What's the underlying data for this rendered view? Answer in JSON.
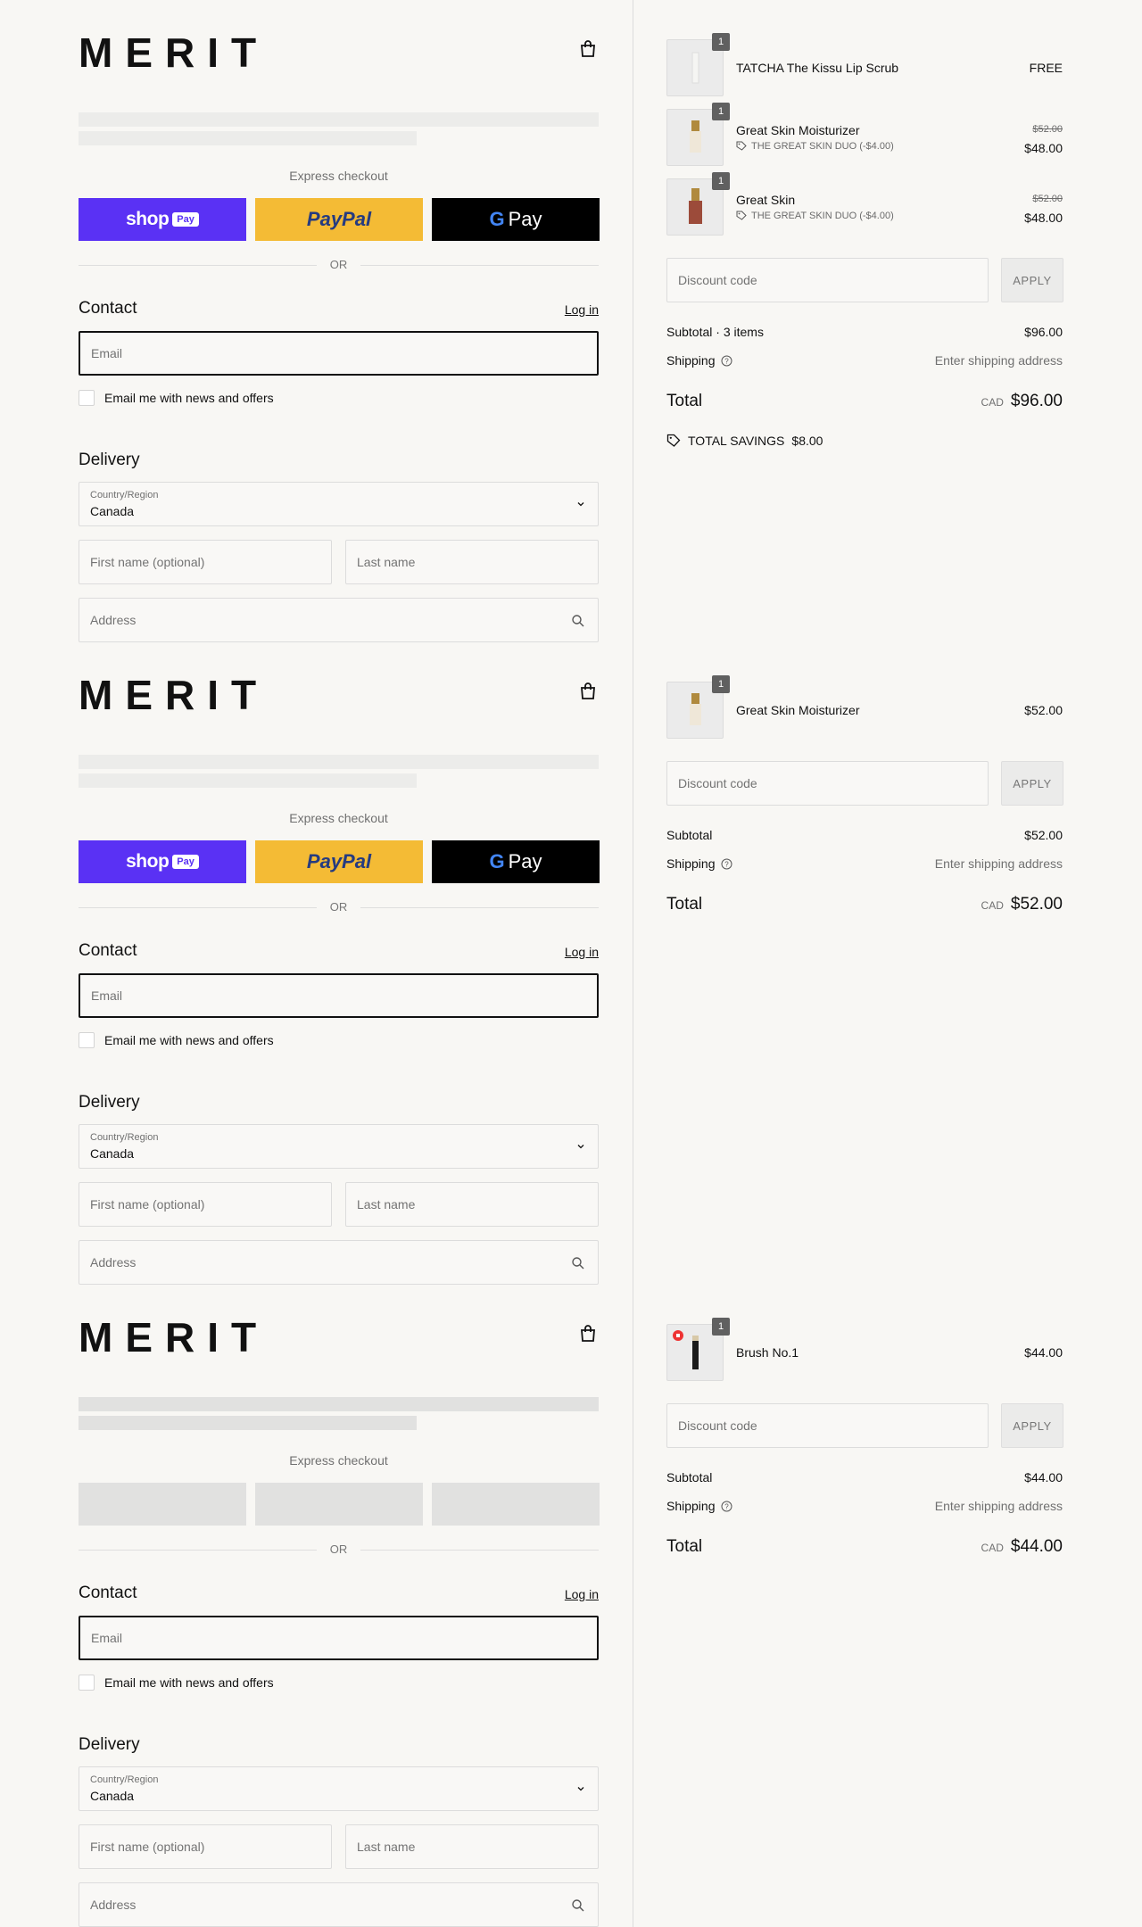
{
  "brand": "MERIT",
  "express_label": "Express checkout",
  "or_label": "OR",
  "pay_buttons": {
    "shop": "shop",
    "shop_badge": "Pay",
    "paypal": "PayPal",
    "gpay": "Pay"
  },
  "contact": {
    "heading": "Contact",
    "login": "Log in",
    "email_placeholder": "Email",
    "newsletter": "Email me with news and offers"
  },
  "delivery": {
    "heading": "Delivery",
    "country_label": "Country/Region",
    "country_value": "Canada",
    "first_name": "First name (optional)",
    "last_name": "Last name",
    "address": "Address"
  },
  "discount": {
    "placeholder": "Discount code",
    "apply": "APPLY"
  },
  "icons": {
    "bag": "bag-icon",
    "chevron": "chevron-down-icon",
    "search": "search-icon",
    "help": "help-icon",
    "tag": "tag-icon"
  },
  "colors": {
    "shop_pay": "#5a31f4",
    "paypal": "#f4bb35",
    "gpay": "#000000"
  },
  "carts": [
    {
      "items": [
        {
          "name": "TATCHA The Kissu Lip Scrub",
          "qty": "1",
          "price": "FREE"
        },
        {
          "name": "Great Skin Moisturizer",
          "qty": "1",
          "original": "$52.00",
          "price": "$48.00",
          "discount": "THE GREAT SKIN DUO (-$4.00)"
        },
        {
          "name": "Great Skin",
          "qty": "1",
          "original": "$52.00",
          "price": "$48.00",
          "discount": "THE GREAT SKIN DUO (-$4.00)"
        }
      ],
      "subtotal_label": "Subtotal · 3 items",
      "subtotal": "$96.00",
      "shipping_label": "Shipping",
      "shipping_value": "Enter shipping address",
      "total_label": "Total",
      "currency": "CAD",
      "total": "$96.00",
      "savings_label": "TOTAL SAVINGS",
      "savings_value": "$8.00"
    },
    {
      "items": [
        {
          "name": "Great Skin Moisturizer",
          "qty": "1",
          "price": "$52.00"
        }
      ],
      "subtotal_label": "Subtotal",
      "subtotal": "$52.00",
      "shipping_label": "Shipping",
      "shipping_value": "Enter shipping address",
      "total_label": "Total",
      "currency": "CAD",
      "total": "$52.00"
    },
    {
      "items": [
        {
          "name": "Brush No.1",
          "qty": "1",
          "price": "$44.00"
        }
      ],
      "subtotal_label": "Subtotal",
      "subtotal": "$44.00",
      "shipping_label": "Shipping",
      "shipping_value": "Enter shipping address",
      "total_label": "Total",
      "currency": "CAD",
      "total": "$44.00"
    }
  ]
}
